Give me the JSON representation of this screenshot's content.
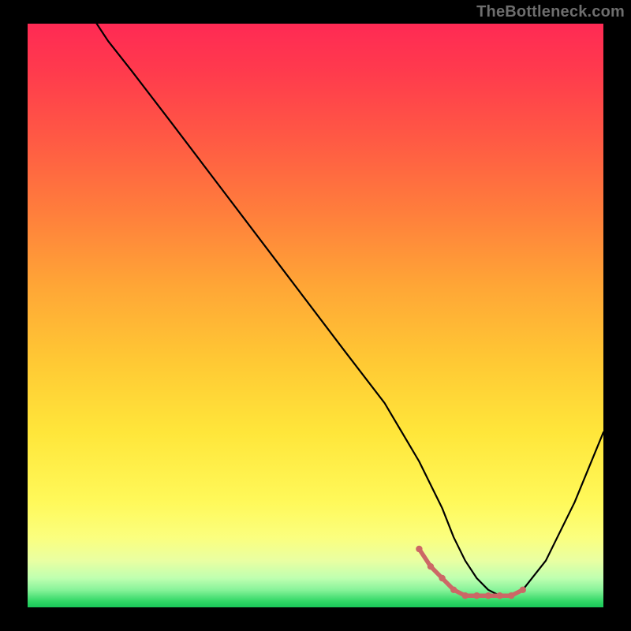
{
  "attribution": "TheBottleneck.com",
  "chart_data": {
    "type": "line",
    "title": "",
    "xlabel": "",
    "ylabel": "",
    "xlim": [
      0,
      100
    ],
    "ylim": [
      0,
      100
    ],
    "background_gradient": {
      "top": "#ff2a54",
      "mid": "#ffe63a",
      "bottom": "#19c659"
    },
    "series": [
      {
        "name": "bottleneck-curve",
        "color": "#000000",
        "x": [
          12,
          14,
          18,
          25,
          35,
          45,
          55,
          62,
          68,
          72,
          74,
          76,
          78,
          80,
          82,
          84,
          86,
          90,
          95,
          100
        ],
        "values": [
          100,
          97,
          92,
          83,
          70,
          57,
          44,
          35,
          25,
          17,
          12,
          8,
          5,
          3,
          2,
          2,
          3,
          8,
          18,
          30
        ]
      }
    ],
    "highlight_region": {
      "name": "optimal-zone",
      "color": "#cc6766",
      "x": [
        68,
        70,
        72,
        74,
        76,
        78,
        80,
        82,
        84,
        86
      ],
      "values": [
        10,
        7,
        5,
        3,
        2,
        2,
        2,
        2,
        2,
        3
      ]
    }
  }
}
